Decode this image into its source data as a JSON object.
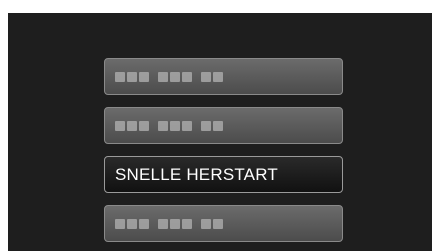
{
  "menu": {
    "items": [
      {
        "label": "",
        "placeholder": true,
        "selected": false
      },
      {
        "label": "",
        "placeholder": true,
        "selected": false
      },
      {
        "label": "SNELLE HERSTART",
        "placeholder": false,
        "selected": true
      },
      {
        "label": "",
        "placeholder": true,
        "selected": false
      }
    ]
  }
}
